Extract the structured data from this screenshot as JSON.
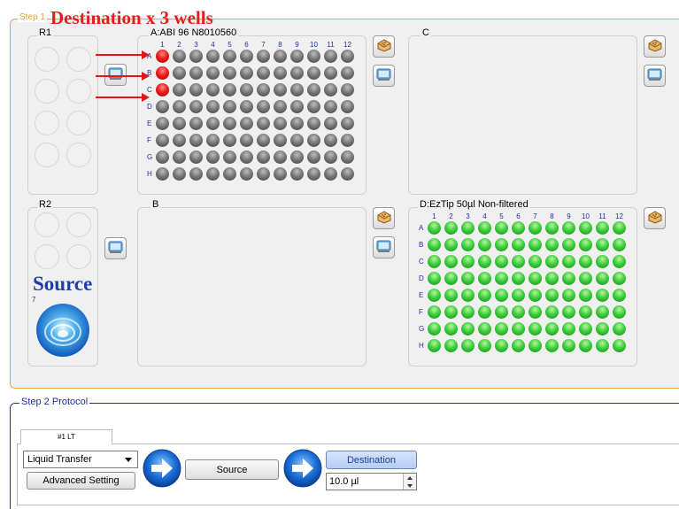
{
  "step1": {
    "legend": "Step 1"
  },
  "annotations": {
    "destination": "Destination x 3 wells",
    "source": "Source"
  },
  "reservoirs": {
    "r1": {
      "title": "R1"
    },
    "r2": {
      "title": "R2",
      "slot_number": "7"
    }
  },
  "plates": {
    "a": {
      "title": "A:ABI 96 N8010560",
      "well_color": "gray",
      "highlighted_wells": [
        "A1",
        "B1",
        "C1"
      ],
      "highlight_color": "red"
    },
    "b": {
      "title": "B"
    },
    "c": {
      "title": "C"
    },
    "d": {
      "title": "D:EzTip 50µl Non-filtered",
      "well_color": "green"
    }
  },
  "plate_grid": {
    "columns": [
      "1",
      "2",
      "3",
      "4",
      "5",
      "6",
      "7",
      "8",
      "9",
      "10",
      "11",
      "12"
    ],
    "rows": [
      "A",
      "B",
      "C",
      "D",
      "E",
      "F",
      "G",
      "H"
    ]
  },
  "step2": {
    "legend": "Step 2 Protocol",
    "tab_label": "#1 LT",
    "protocol_select": "Liquid Transfer",
    "advanced_button": "Advanced Setting",
    "source_button": "Source",
    "destination_button": "Destination",
    "volume_value": "10.0 µl"
  },
  "icons": {
    "plate_button_icon": "plate-icon",
    "tip_button_icon": "tip-box-icon",
    "next_step_icon": "arrow-right-circle-icon",
    "reservoir_icon": "reservoir-swirl-icon"
  },
  "colors": {
    "step1_border": "#e3a54a",
    "step2_border": "#1f2fa0",
    "annotation_red": "#e02020",
    "annotation_blue": "#1f3fb0"
  }
}
